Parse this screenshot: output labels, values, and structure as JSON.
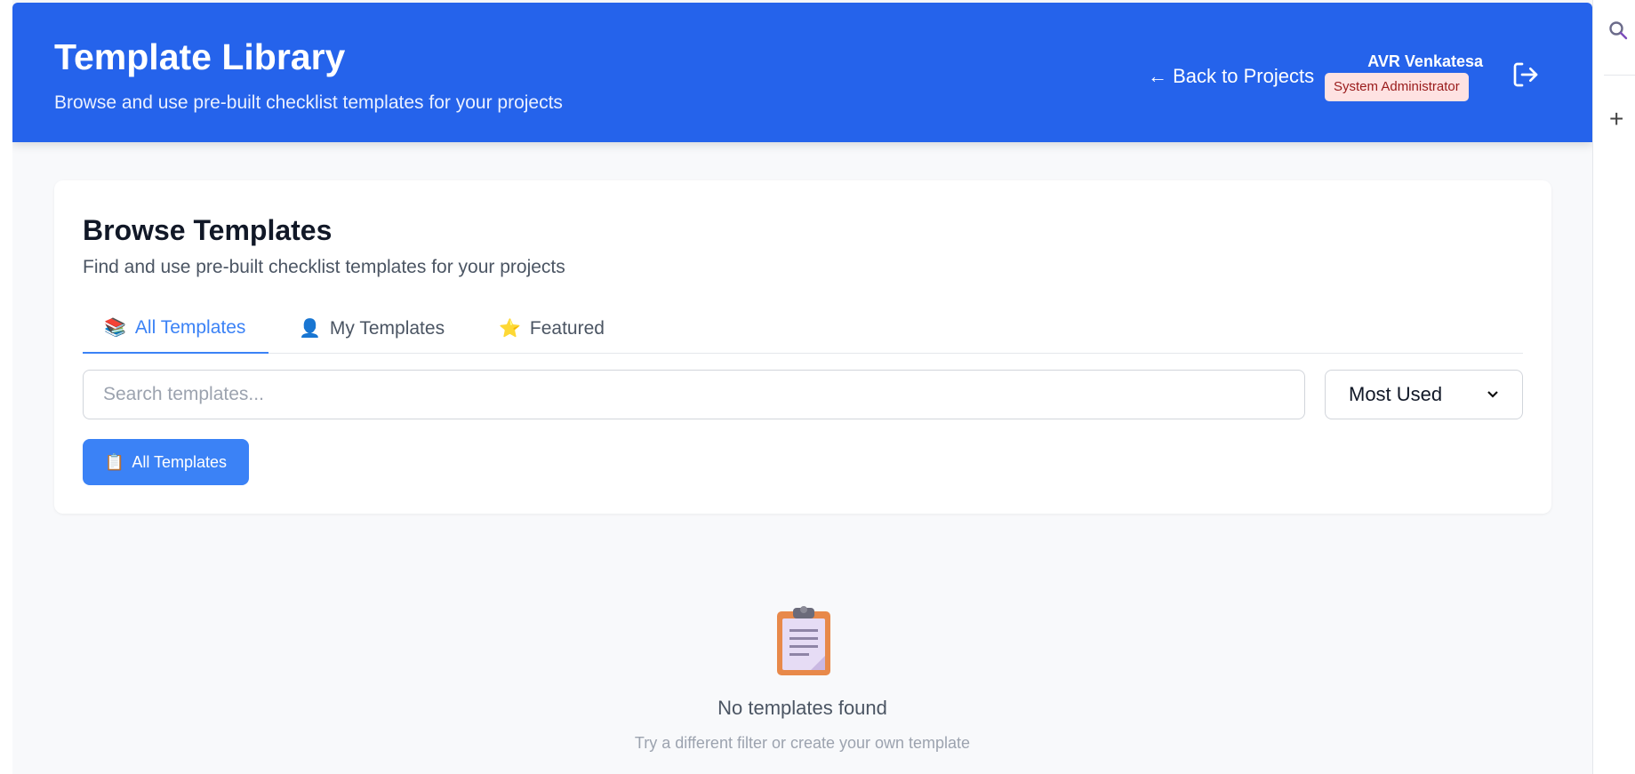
{
  "header": {
    "title": "Template Library",
    "subtitle": "Browse and use pre-built checklist templates for your projects",
    "back_link": "← Back to Projects",
    "user_name": "AVR Venkatesa",
    "user_role": "System Administrator",
    "logout_icon": "logout-icon"
  },
  "browse": {
    "title": "Browse Templates",
    "subtitle": "Find and use pre-built checklist templates for your projects",
    "tabs": [
      {
        "label": "All Templates",
        "icon": "📚",
        "active": true
      },
      {
        "label": "My Templates",
        "icon": "👤",
        "active": false
      },
      {
        "label": "Featured",
        "icon": "⭐",
        "active": false
      }
    ],
    "search_placeholder": "Search templates...",
    "sort_value": "Most Used",
    "filter_button": {
      "label": "All Templates",
      "icon": "📋"
    }
  },
  "empty_state": {
    "icon": "clipboard-icon",
    "title": "No templates found",
    "subtitle": "Try a different filter or create your own template"
  },
  "colors": {
    "header_bg": "#2563eb",
    "accent": "#3b82f6",
    "badge_bg": "#fee2e2",
    "badge_text": "#991b1b"
  }
}
